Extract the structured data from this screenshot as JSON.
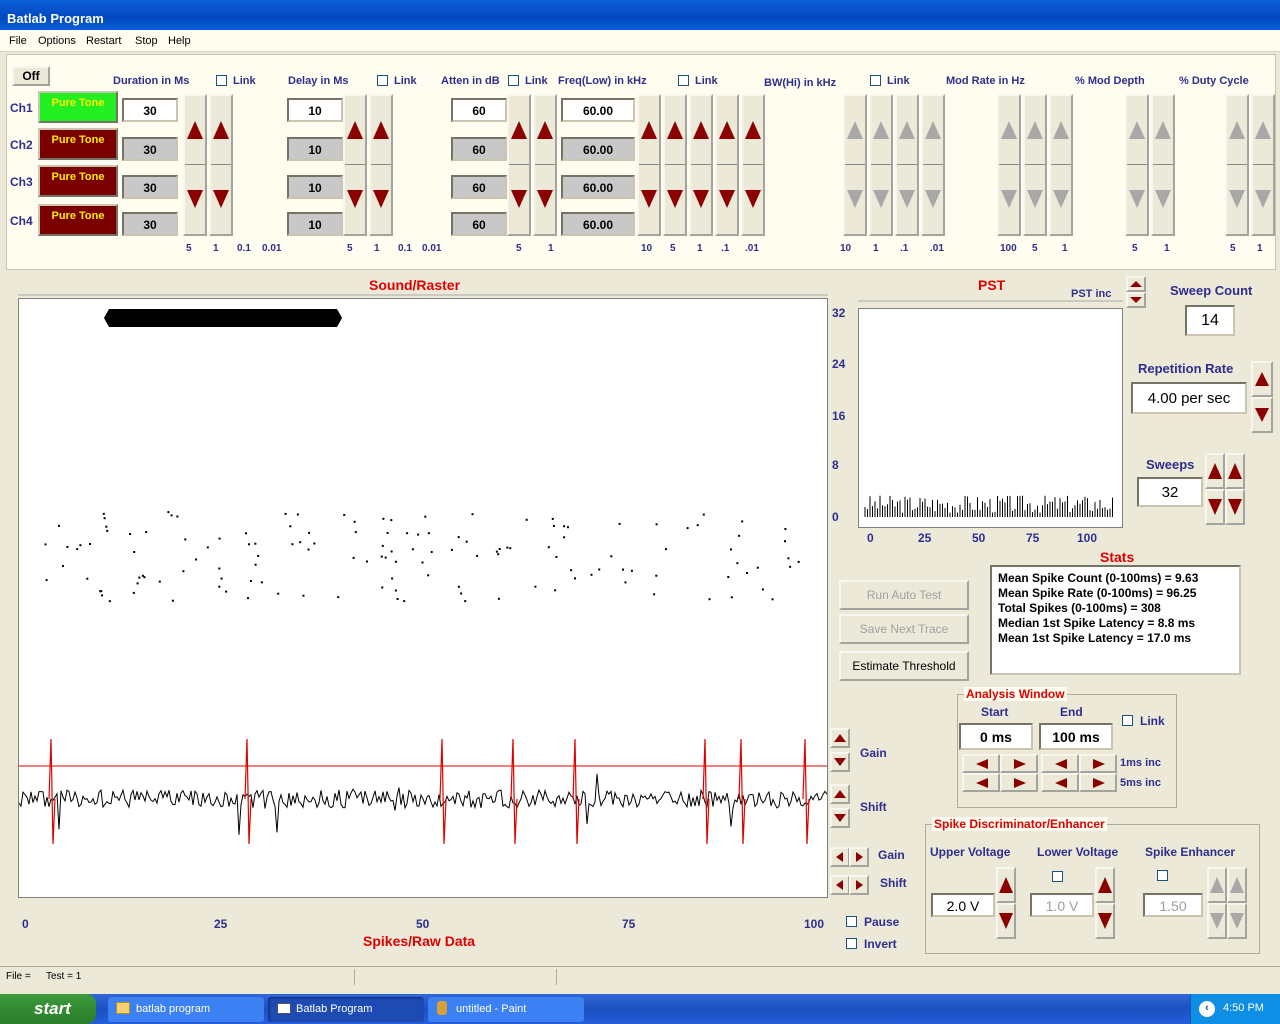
{
  "app": {
    "title": "Batlab Program"
  },
  "menu": [
    "File",
    "Options",
    "Restart",
    "Stop",
    "Help"
  ],
  "top": {
    "off_label": "Off",
    "headers": {
      "duration": "Duration in Ms",
      "delay": "Delay in Ms",
      "atten": "Atten in dB",
      "freq": "Freq(Low) in kHz",
      "bw": "BW(Hi) in kHz",
      "modrate": "Mod Rate in Hz",
      "moddepth": "% Mod Depth",
      "duty": "% Duty Cycle",
      "link": "Link"
    },
    "channels": [
      {
        "label": "Ch1",
        "type": "Pure Tone",
        "duration": "30",
        "delay": "10",
        "atten": "60",
        "freq": "60.00",
        "active": true
      },
      {
        "label": "Ch2",
        "type": "Pure Tone",
        "duration": "30",
        "delay": "10",
        "atten": "60",
        "freq": "60.00",
        "active": false
      },
      {
        "label": "Ch3",
        "type": "Pure Tone",
        "duration": "30",
        "delay": "10",
        "atten": "60",
        "freq": "60.00",
        "active": false
      },
      {
        "label": "Ch4",
        "type": "Pure Tone",
        "duration": "30",
        "delay": "10",
        "atten": "60",
        "freq": "60.00",
        "active": false
      }
    ],
    "increments": {
      "duration": [
        "5",
        "1",
        "0.1",
        "0.01"
      ],
      "delay": [
        "5",
        "1",
        "0.1",
        "0.01"
      ],
      "atten": [
        "5",
        "1"
      ],
      "freq": [
        "10",
        "5",
        "1",
        ".1",
        ".01"
      ],
      "bw": [
        "10",
        "1",
        ".1",
        ".01"
      ],
      "modrate": [
        "100",
        "5",
        "1"
      ],
      "moddepth": [
        "5",
        "1"
      ],
      "duty": [
        "5",
        "1"
      ]
    }
  },
  "raster": {
    "title": "Sound/Raster",
    "xlabel": "Spikes/Raw Data",
    "xticks": [
      "0",
      "25",
      "50",
      "75",
      "100"
    ],
    "gain_label": "Gain",
    "shift_label": "Shift",
    "hgain_label": "Gain",
    "hshift_label": "Shift",
    "pause_label": "Pause",
    "invert_label": "Invert"
  },
  "pst": {
    "title": "PST",
    "inc_label": "PST inc",
    "yticks": [
      "32",
      "24",
      "16",
      "8",
      "0"
    ],
    "xticks": [
      "0",
      "25",
      "50",
      "75",
      "100"
    ]
  },
  "sweep_count": {
    "label": "Sweep Count",
    "value": "14"
  },
  "repetition": {
    "label": "Repetition Rate",
    "value": "4.00 per sec"
  },
  "sweeps": {
    "label": "Sweeps",
    "value": "32"
  },
  "stats": {
    "title": "Stats",
    "lines": [
      "Mean Spike Count (0-100ms) =  9.63",
      "Mean Spike Rate (0-100ms) = 96.25",
      "Total Spikes (0-100ms) = 308",
      "Median 1st Spike Latency =  8.8 ms",
      "Mean 1st Spike Latency = 17.0 ms"
    ]
  },
  "buttons": {
    "run_auto_test": "Run Auto Test",
    "save_next_trace": "Save Next Trace",
    "estimate_threshold": "Estimate Threshold"
  },
  "analysis": {
    "title": "Analysis Window",
    "start_label": "Start",
    "end_label": "End",
    "start_value": "0 ms",
    "end_value": "100 ms",
    "link_label": "Link",
    "inc1": "1ms inc",
    "inc5": "5ms inc"
  },
  "spike": {
    "title": "Spike Discriminator/Enhancer",
    "upper_label": "Upper Voltage",
    "lower_label": "Lower Voltage",
    "enhancer_label": "Spike Enhancer",
    "upper_value": "2.0 V",
    "lower_value": "1.0 V",
    "enhancer_value": "1.50"
  },
  "status": {
    "file": "File =",
    "test": "Test = 1"
  },
  "taskbar": {
    "start": "start",
    "tasks": [
      "batlab program",
      "Batlab Program",
      "untitled - Paint"
    ],
    "time": "4:50 PM"
  },
  "colors": {
    "accent_red": "#8b0000",
    "title_blue": "#2e2e8f",
    "plot_red": "#e00000",
    "active_green": "#22ee22",
    "inactive_maroon": "#7a0000"
  }
}
